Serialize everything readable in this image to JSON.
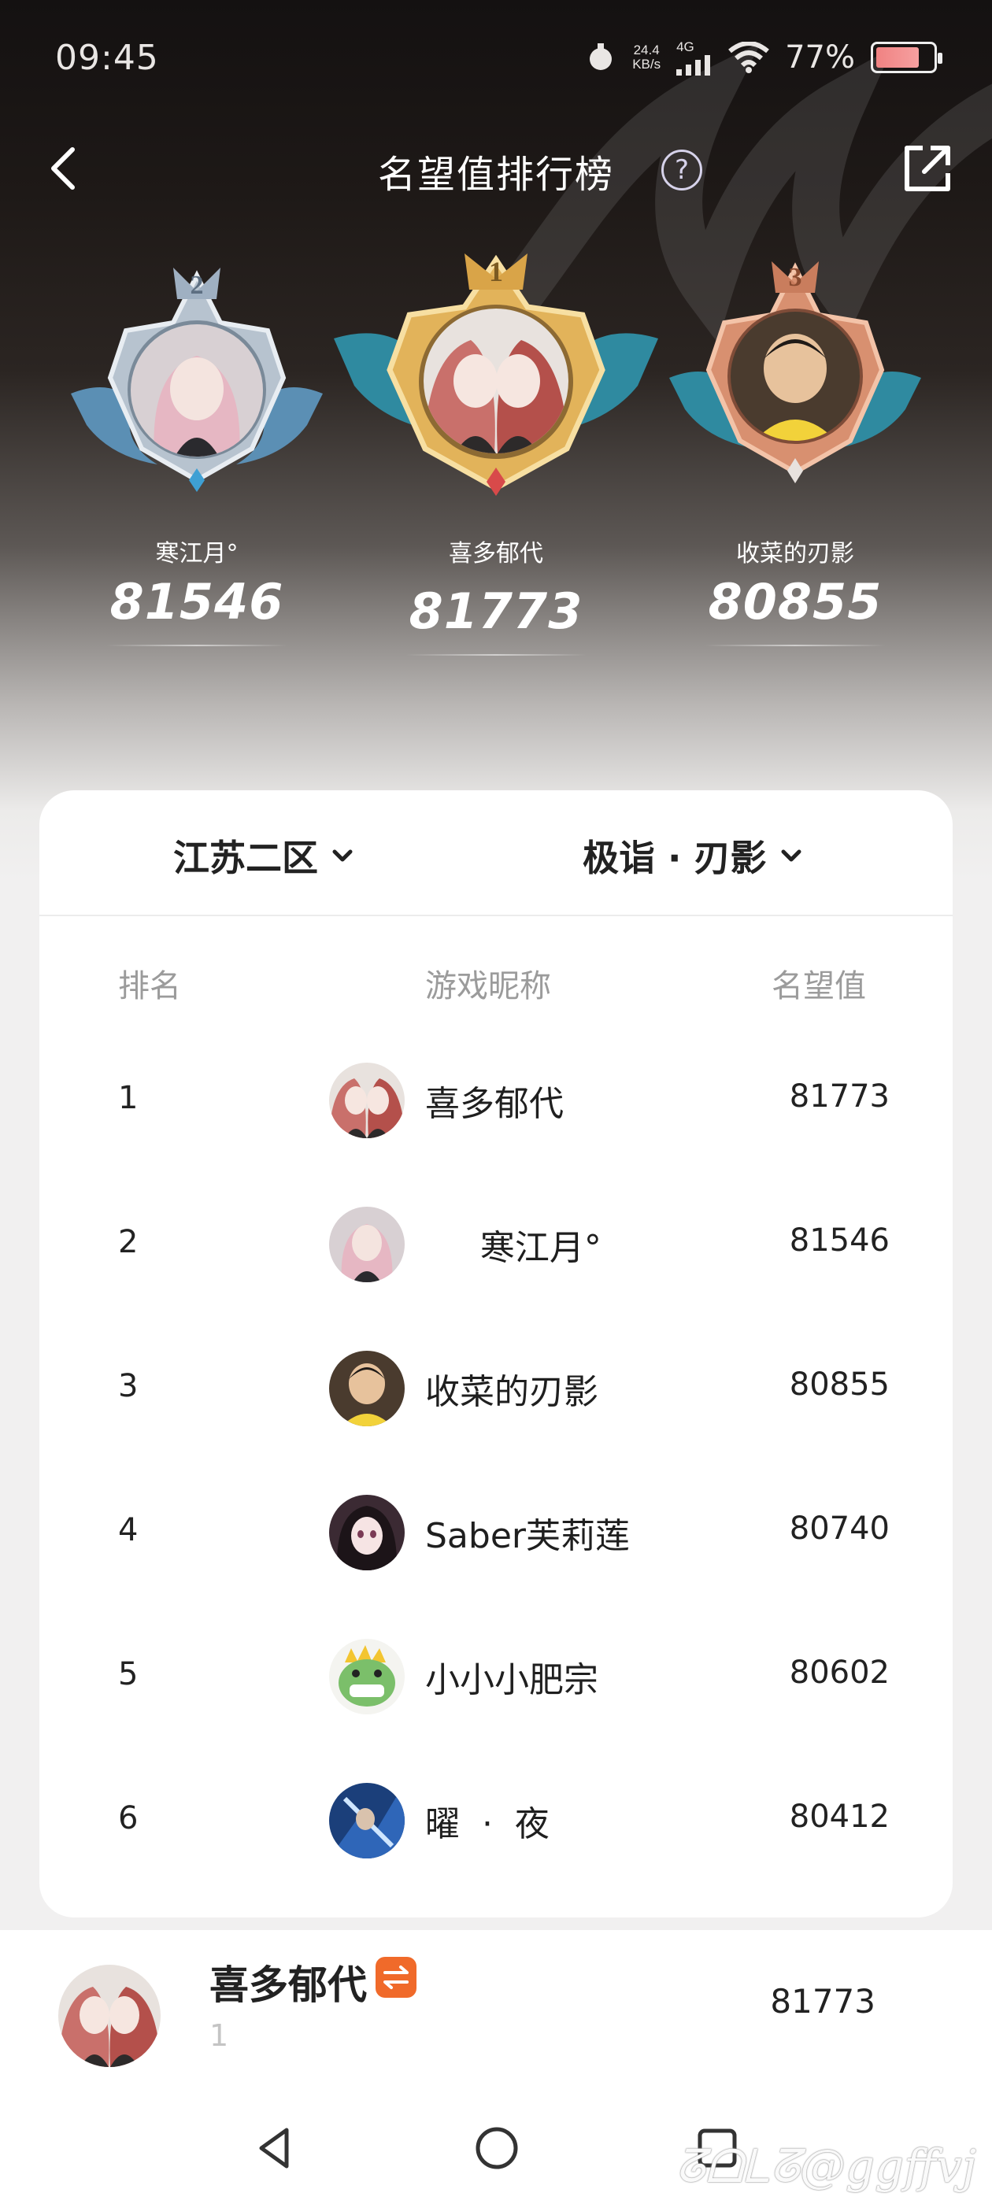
{
  "status_bar": {
    "time": "09:45",
    "net_speed_value": "24.4",
    "net_speed_unit": "KB/s",
    "network_type": "4G",
    "battery_percent": "77%",
    "battery_level": 0.77
  },
  "header": {
    "title": "名望值排行榜",
    "help_symbol": "?"
  },
  "podium": {
    "first": {
      "rank": "1",
      "name": "喜多郁代",
      "score": "81773"
    },
    "second": {
      "rank": "2",
      "name": "寒江月°",
      "score": "81546"
    },
    "third": {
      "rank": "3",
      "name": "收菜的刃影",
      "score": "80855"
    }
  },
  "filters": {
    "server": "江苏二区",
    "hero": "极诣 · 刃影"
  },
  "table": {
    "columns": {
      "rank": "排名",
      "name": "游戏昵称",
      "score": "名望值"
    },
    "rows": [
      {
        "rank": "1",
        "name": "喜多郁代",
        "score": "81773",
        "avatar": "anime-duo"
      },
      {
        "rank": "2",
        "name": "     寒江月°",
        "score": "81546",
        "avatar": "pink-hair-girl"
      },
      {
        "rank": "3",
        "name": "收菜的刃影",
        "score": "80855",
        "avatar": "toddler-photo"
      },
      {
        "rank": "4",
        "name": "Saber芙莉莲",
        "score": "80740",
        "avatar": "dark-hair-girl"
      },
      {
        "rank": "5",
        "name": "小小小肥宗",
        "score": "80602",
        "avatar": "green-dino"
      },
      {
        "rank": "6",
        "name": "曜  ·  夜",
        "score": "80412",
        "avatar": "blue-warrior"
      }
    ]
  },
  "my_entry": {
    "name": "喜多郁代",
    "rank": "1",
    "score": "81773",
    "tag_icon": "swap-arrows-icon"
  },
  "watermark": "ᘔᗝᒪᘔ@ggffvj",
  "colors": {
    "accent_orange": "#f06a2a",
    "gold": "#e2b35a",
    "silver": "#a9b7c6",
    "bronze": "#d89070"
  }
}
